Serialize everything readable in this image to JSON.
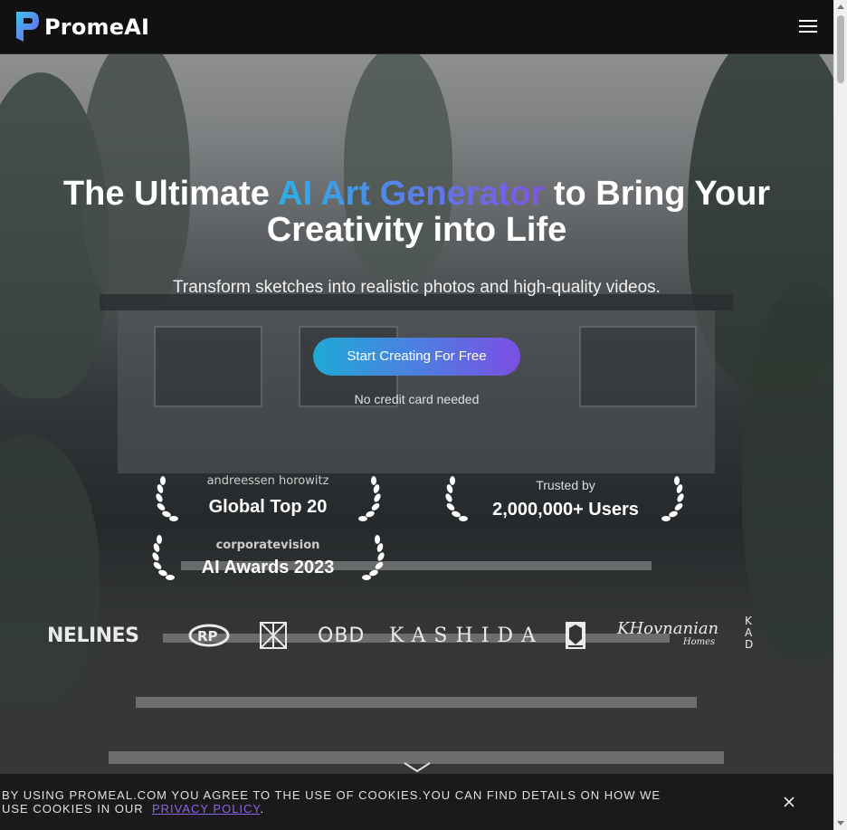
{
  "header": {
    "brand_name": "PromeAI",
    "logo_icon": "promeai-logo-icon",
    "menu_icon": "hamburger-menu-icon"
  },
  "hero": {
    "headline_part1": "The Ultimate ",
    "headline_highlight": "AI Art Generator",
    "headline_part2": " to Bring Your Creativity into Life",
    "subheadline": "Transform sketches into realistic photos and high-quality videos.",
    "cta_label": "Start Creating For Free",
    "cta_note": "No credit card needed",
    "accent_gradient": [
      "#29b2e6",
      "#5a7fe8",
      "#7f55e6"
    ]
  },
  "awards": [
    {
      "logo_text": "andreessen horowitz",
      "title": "Global Top 20"
    },
    {
      "logo_text": "Trusted by",
      "title": "2,000,000+ Users"
    },
    {
      "logo_text": "corporatevision",
      "title": "AI Awards 2023"
    }
  ],
  "partners": [
    {
      "name": "FINELINES",
      "shown": "NELINES"
    },
    {
      "name": "RP",
      "shown": "RP"
    },
    {
      "name": "monogram-logo",
      "shown": ""
    },
    {
      "name": "OBD",
      "shown": "OBD"
    },
    {
      "name": "KASHIDA",
      "shown": "KASHIDA"
    },
    {
      "name": "crest-logo",
      "shown": ""
    },
    {
      "name": "K.Hovnanian Homes",
      "shown": "KHovnanian"
    },
    {
      "name": "K.Hovnanian Homes sub",
      "shown": "Homes"
    },
    {
      "name": "KAD",
      "shown": "KAD"
    }
  ],
  "scroll_hint_icon": "chevron-down-icon",
  "cookie_banner": {
    "text": "By using promeal.com you agree to the use of cookies.You can find details on how we use cookies in our",
    "link_label": "Privacy Policy",
    "suffix": ".",
    "close_icon": "close-icon"
  }
}
